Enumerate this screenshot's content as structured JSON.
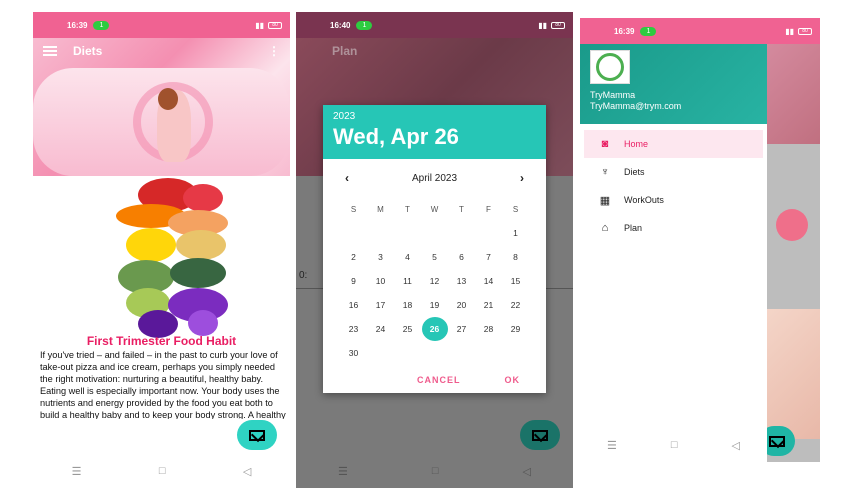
{
  "screen1": {
    "status": {
      "time": "16:39",
      "pill": "1",
      "battery": "80"
    },
    "toolbar": {
      "title": "Diets",
      "menu_icon": "menu-icon",
      "overflow": "⋮"
    },
    "food_title": "First Trimester Food Habit",
    "food_text": "If you've tried – and failed – in the past to curb your love of take-out pizza and ice cream, perhaps you simply needed the right motivation: nurturing a beautiful, healthy baby. Eating well is especially important now. Your body uses the nutrients and energy provided by the food you eat both to build a healthy baby and to keep your body strong. A healthy",
    "fab_icon": "mail-icon",
    "nav": {
      "recents": "☰",
      "home": "□",
      "back": "◁"
    }
  },
  "screen2": {
    "status": {
      "time": "16:40",
      "pill": "1",
      "battery": "80"
    },
    "toolbar": {
      "title": "Plan"
    },
    "behind_label": "0:",
    "dialog": {
      "year": "2023",
      "date": "Wed, Apr 26",
      "month_label": "April 2023",
      "prev": "‹",
      "next": "›",
      "weekdays": [
        "S",
        "M",
        "T",
        "W",
        "T",
        "F",
        "S"
      ],
      "days": [
        "",
        "",
        "",
        "",
        "",
        "",
        "1",
        "2",
        "3",
        "4",
        "5",
        "6",
        "7",
        "8",
        "9",
        "10",
        "11",
        "12",
        "13",
        "14",
        "15",
        "16",
        "17",
        "18",
        "19",
        "20",
        "21",
        "22",
        "23",
        "24",
        "25",
        "26",
        "27",
        "28",
        "29",
        "30",
        "",
        "",
        "",
        "",
        "",
        ""
      ],
      "selected": "26",
      "cancel": "CANCEL",
      "ok": "OK"
    },
    "nav": {
      "recents": "☰",
      "home": "□",
      "back": "◁"
    }
  },
  "screen3": {
    "status": {
      "time": "16:39",
      "pill": "1",
      "battery": "80"
    },
    "drawer": {
      "name": "TryMamma",
      "email": "TryMamma@trym.com",
      "items": [
        {
          "label": "Home",
          "icon": "camera-icon",
          "glyph": "◙",
          "active": true
        },
        {
          "label": "Diets",
          "icon": "diet-icon",
          "glyph": "♆",
          "active": false
        },
        {
          "label": "WorkOuts",
          "icon": "calendar-icon",
          "glyph": "▦",
          "active": false
        },
        {
          "label": "Plan",
          "icon": "plan-icon",
          "glyph": "⌂",
          "active": false
        }
      ]
    },
    "nav": {
      "recents": "☰",
      "home": "□",
      "back": "◁"
    }
  },
  "colors": {
    "pink": "#f06292",
    "teal": "#26c6b6",
    "accent_text": "#e91e63"
  }
}
